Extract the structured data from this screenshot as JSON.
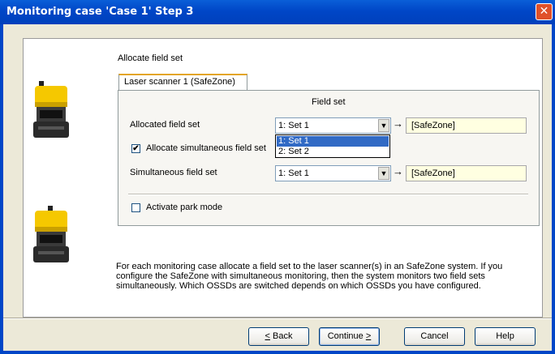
{
  "window": {
    "title": "Monitoring case 'Case 1' Step 3",
    "close_label": "✕"
  },
  "section_title": "Allocate field set",
  "tab_label": "Laser scanner 1 (SafeZone)",
  "field_set_heading": "Field set",
  "allocated": {
    "label": "Allocated field set",
    "value": "1: Set 1",
    "result": "[SafeZone]"
  },
  "simultaneous_checkbox": {
    "label": "Allocate simultaneous field set",
    "checked": true,
    "mark": "✔"
  },
  "dropdown_options": [
    {
      "label": "1: Set 1",
      "selected": true
    },
    {
      "label": "2: Set 2",
      "selected": false
    }
  ],
  "simultaneous": {
    "label": "Simultaneous field set",
    "value": "1: Set 1",
    "result": "[SafeZone]"
  },
  "park_mode": {
    "label": "Activate park mode",
    "checked": false
  },
  "arrow": "→",
  "description_lines": [
    "For each monitoring case allocate a field set to the laser scanner(s) in an SafeZone system. If you",
    "configure the SafeZone with simultaneous monitoring, then the system monitors two field sets",
    "simultaneously. Which OSSDs are switched depends on which OSSDs you have configured."
  ],
  "buttons": {
    "back_underline": "<",
    "back_rest": " Back",
    "continue_main": "Continue ",
    "continue_underline": ">",
    "cancel": "Cancel",
    "help": "Help"
  },
  "icons": {
    "dropdown_arrow": "▼",
    "scanner": "safety-laser-scanner-icon"
  },
  "colors": {
    "title_bar": "#0046c7",
    "selection": "#316ac5",
    "readonly_field": "#ffffe1",
    "scanner_yellow": "#f5c800"
  }
}
